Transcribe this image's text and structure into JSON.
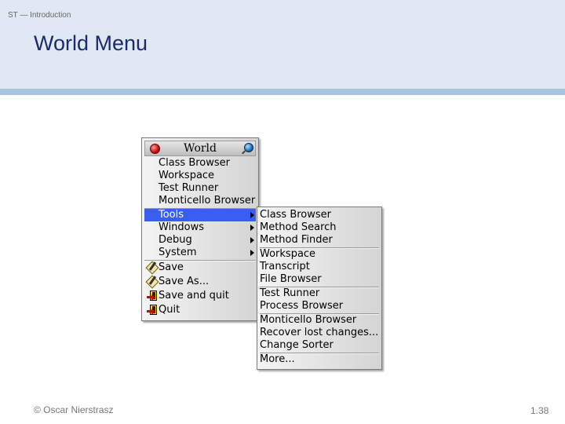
{
  "slide": {
    "breadcrumb": "ST — Introduction",
    "title": "World Menu",
    "footer_left": "© Oscar Nierstrasz",
    "footer_right": "1.38"
  },
  "world_menu": {
    "title": "World",
    "items": [
      {
        "label": "Class Browser"
      },
      {
        "label": "Workspace"
      },
      {
        "label": "Test Runner"
      },
      {
        "label": "Monticello Browser"
      },
      {
        "label": "Tools",
        "selected": true,
        "submenu": true
      },
      {
        "label": "Windows",
        "submenu": true
      },
      {
        "label": "Debug",
        "submenu": true
      },
      {
        "label": "System",
        "submenu": true
      },
      {
        "label": "Save",
        "icon": "save-icon"
      },
      {
        "label": "Save As...",
        "icon": "save-icon"
      },
      {
        "label": "Save and quit",
        "icon": "quit-icon"
      },
      {
        "label": "Quit",
        "icon": "quit-icon"
      }
    ]
  },
  "tools_menu": {
    "items": [
      {
        "label": "Class Browser"
      },
      {
        "label": "Method Search"
      },
      {
        "label": "Method Finder"
      },
      {
        "label": "Workspace"
      },
      {
        "label": "Transcript"
      },
      {
        "label": "File Browser"
      },
      {
        "label": "Test Runner"
      },
      {
        "label": "Process Browser"
      },
      {
        "label": "Monticello Browser"
      },
      {
        "label": "Recover lost changes..."
      },
      {
        "label": "Change Sorter"
      },
      {
        "label": "More..."
      }
    ]
  },
  "colors": {
    "header_bg": "#dfe8f3",
    "header_bar": "#a9c4de",
    "title_text": "#1a2a6c",
    "selection": "#3a5ff0"
  }
}
